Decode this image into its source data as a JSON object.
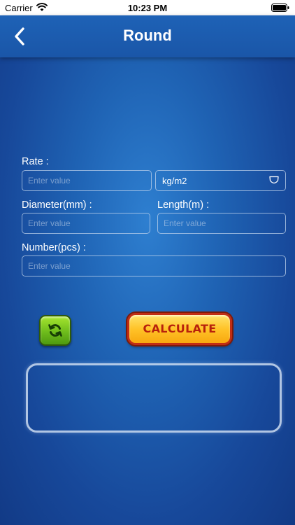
{
  "status_bar": {
    "carrier": "Carrier",
    "time": "10:23 PM"
  },
  "nav": {
    "title": "Round",
    "back_icon": "chevron-left-icon"
  },
  "form": {
    "rate": {
      "label": "Rate :",
      "placeholder": "Enter value",
      "value": ""
    },
    "unit": {
      "selected": "kg/m2",
      "icon": "chevron-down-icon"
    },
    "diameter": {
      "label": "Diameter(mm) :",
      "placeholder": "Enter value",
      "value": ""
    },
    "length": {
      "label": "Length(m) :",
      "placeholder": "Enter value",
      "value": ""
    },
    "number": {
      "label": "Number(pcs) :",
      "placeholder": "Enter value",
      "value": ""
    }
  },
  "actions": {
    "reset_icon": "refresh-icon",
    "calculate_label": "CALCULATE"
  },
  "result": {
    "text": ""
  },
  "colors": {
    "background": "#1f63b4",
    "nav_bar": "#1e62b6",
    "reset_button": "#7cc520",
    "calculate_button": "#ffc328",
    "calculate_text": "#b8210c"
  }
}
